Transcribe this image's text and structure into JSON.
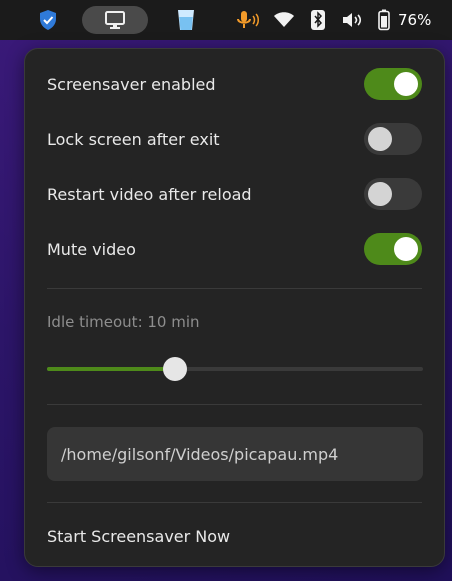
{
  "topbar": {
    "battery_percent": "76%",
    "colors": {
      "shield_blue": "#2f7ad9",
      "mic_orange": "#f39b2a",
      "cup_blue": "#78c1f1"
    },
    "icons": [
      "shield-icon",
      "monitor-icon",
      "cup-icon",
      "microphone-icon",
      "wifi-icon",
      "bluetooth-icon",
      "volume-icon",
      "battery-icon"
    ]
  },
  "panel": {
    "toggles": [
      {
        "label": "Screensaver enabled",
        "on": true
      },
      {
        "label": "Lock screen after exit",
        "on": false
      },
      {
        "label": "Restart video after reload",
        "on": false
      },
      {
        "label": "Mute video",
        "on": true
      }
    ],
    "idle_label": "Idle timeout: 10 min",
    "idle_slider_fraction": 0.34,
    "video_path": "/home/gilsonf/Videos/picapau.mp4",
    "start_label": "Start Screensaver Now",
    "accent_color": "#4e8a1a"
  }
}
